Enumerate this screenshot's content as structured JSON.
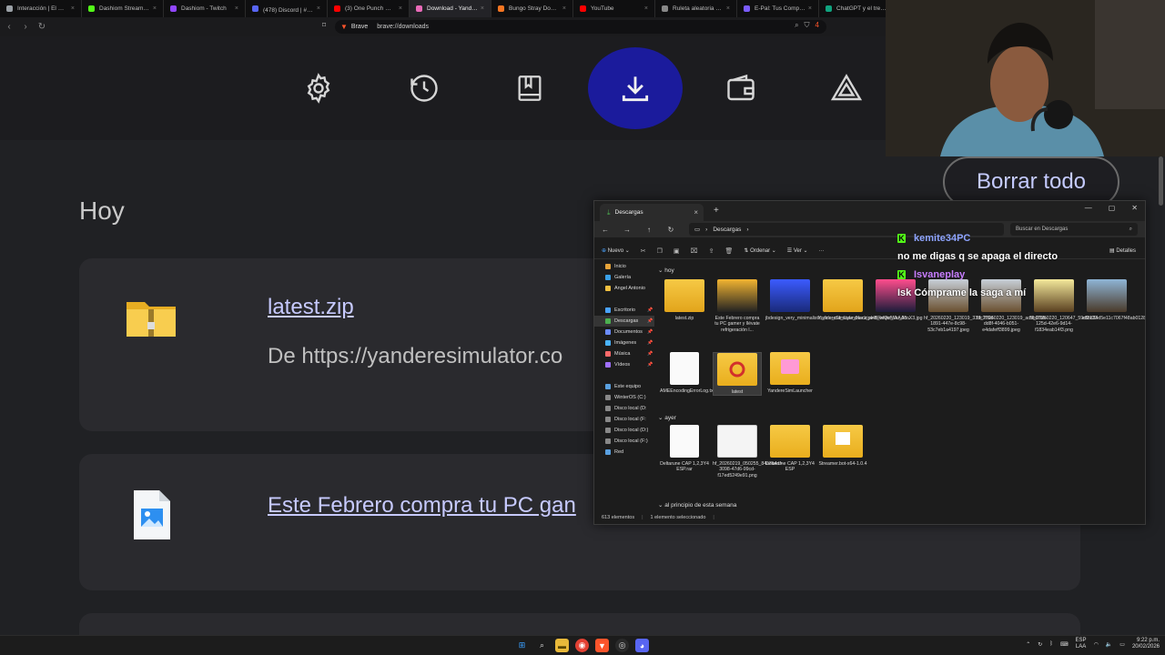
{
  "browser": {
    "tabs": [
      {
        "label": "Interacción | El mejor sc",
        "color": "#9aa0a6"
      },
      {
        "label": "Dashiom Stream - Watc",
        "color": "#53fc18"
      },
      {
        "label": "Dashiom - Twitch",
        "color": "#9146ff"
      },
      {
        "label": "(478) Discord | #|·卍·su",
        "color": "#5865f2"
      },
      {
        "label": "(3) One Punch Man OST",
        "color": "#ff0000"
      },
      {
        "label": "Download - Yandere Sim",
        "color": "#e86ab8"
      },
      {
        "label": "Bungo Stray Dogs en Es",
        "color": "#f47521"
      },
      {
        "label": "YouTube",
        "color": "#ff0000"
      },
      {
        "label": "Ruleta aleatoria online -",
        "color": "#888888"
      },
      {
        "label": "E-Pal: Tus Compañeros",
        "color": "#7b5cff"
      },
      {
        "label": "ChatGPT y el tren d",
        "color": "#10a37f"
      }
    ],
    "address": {
      "site": "Brave",
      "path": "brave://downloads",
      "badge": "4"
    }
  },
  "downloads": {
    "nav_icons": [
      "settings-icon",
      "history-icon",
      "bookmarks-icon",
      "downloads-icon",
      "wallet-icon",
      "rewards-icon"
    ],
    "section": "Hoy",
    "clear_all": "Borrar todo",
    "items": [
      {
        "name": "latest.zip",
        "from": "De https://yanderesimulator.co"
      },
      {
        "name": "Este Febrero compra tu PC gan"
      }
    ]
  },
  "explorer": {
    "tab_title": "Descargas",
    "breadcrumb": "Descargas",
    "search_placeholder": "Buscar en Descargas",
    "toolbar": {
      "new": "Nuevo",
      "sort": "Ordenar",
      "view": "Ver",
      "details": "Detalles"
    },
    "sidebar": [
      {
        "label": "Inicio",
        "color": "#e7a43a",
        "pin": false
      },
      {
        "label": "Galería",
        "color": "#3aa0e7",
        "pin": false
      },
      {
        "label": "Angel Antonio",
        "color": "#f0c040",
        "pin": false
      },
      {
        "label": "",
        "color": "",
        "pin": false
      },
      {
        "label": "Escritorio",
        "color": "#4aa3ff",
        "pin": true
      },
      {
        "label": "Descargas",
        "color": "#4caf50",
        "pin": true,
        "selected": true
      },
      {
        "label": "Documentos",
        "color": "#6b8cff",
        "pin": true
      },
      {
        "label": "Imágenes",
        "color": "#4ab3ff",
        "pin": true
      },
      {
        "label": "Música",
        "color": "#ff6a6a",
        "pin": true
      },
      {
        "label": "Vídeos",
        "color": "#a070ff",
        "pin": true
      },
      {
        "label": "",
        "color": "",
        "pin": false
      },
      {
        "label": "Este equipo",
        "color": "#5aa0e0",
        "pin": false
      },
      {
        "label": "WinterOS (C:)",
        "color": "#888",
        "pin": false
      },
      {
        "label": "Disco local (D:",
        "color": "#888",
        "pin": false
      },
      {
        "label": "Disco local (F:",
        "color": "#888",
        "pin": false
      },
      {
        "label": "Disco local (D:)",
        "color": "#888",
        "pin": false
      },
      {
        "label": "Disco local (F:)",
        "color": "#888",
        "pin": false
      },
      {
        "label": "Red",
        "color": "#5aa0e0",
        "pin": false
      }
    ],
    "groups": {
      "today": "hoy",
      "yesterday": "ayer",
      "earlier": "al principio de esta semana"
    },
    "files_today": [
      {
        "name": "latest.zip",
        "kind": "zip"
      },
      {
        "name": "Este Febrero compra tu PC gamer y llévate refrigeración l...",
        "kind": "image-ad"
      },
      {
        "name": "jbdesign_very_minimalistic_lino_cut_style_black_and_white_illu_35...",
        "kind": "image-blue"
      },
      {
        "name": "YandereSimLauncher.zip",
        "kind": "zip"
      },
      {
        "name": "HBReQcfWkAAcnX3.jpg",
        "kind": "image-pink"
      },
      {
        "name": "hf_20260220_123019_333c776d-1891-447e-8c98-53c7eb1a4197.jpeg",
        "kind": "image-dog"
      },
      {
        "name": "hf_20260220_123019_ac5b67bb-dd8f-4046-b051-e4dafeff3899.jpeg",
        "kind": "image-dog"
      },
      {
        "name": "hf_20260220_120647_59cf2133-125d-42e6-9d14-f1834eab14f3.png",
        "kind": "image-dog2"
      },
      {
        "name": "e8bd24d5e11c7067f48ab01288a2c8.webp",
        "kind": "image-dog3"
      },
      {
        "name": "AMEEncodingErrorLog.txt",
        "kind": "doc"
      },
      {
        "name": "latest",
        "kind": "folder-red",
        "selected": true
      },
      {
        "name": "YandereSimLauncher",
        "kind": "folder-pink"
      }
    ],
    "files_yesterday": [
      {
        "name": "Deltarune CAP 1,2,3Y4 ESP.rar",
        "kind": "doc"
      },
      {
        "name": "hf_20260219_050255_84a3a4df-3098-47d6-99cd-f17ed5249e91.png",
        "kind": "image-sketch"
      },
      {
        "name": "Deltarune CAP 1,2,3Y4 ESP",
        "kind": "folder"
      },
      {
        "name": "Streamer.bot-x64-1.0.4",
        "kind": "folder-files"
      }
    ],
    "status": {
      "count": "613 elementos",
      "selected": "1 elemento seleccionado"
    }
  },
  "chat": [
    {
      "user": "kemite34PC",
      "color": "#8ea4ff",
      "message": "no me digas q se apaga el directo"
    },
    {
      "user": "Isvaneplay",
      "color": "#c77dff",
      "message": "Isk Cómprame la saga a mí"
    }
  ],
  "taskbar": {
    "lang": "ESP",
    "lang2": "LAA",
    "time": "9:22 p.m.",
    "date": "20/02/2026"
  }
}
